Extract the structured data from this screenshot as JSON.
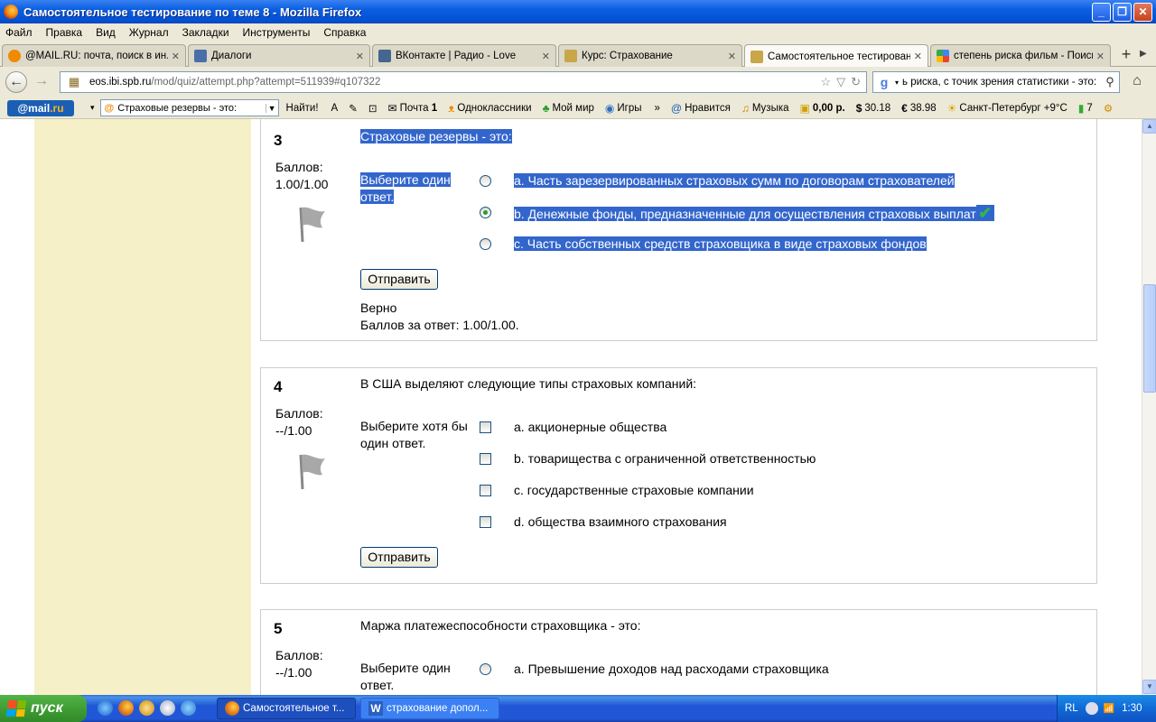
{
  "window": {
    "title": "Самостоятельное тестирование по теме 8 - Mozilla Firefox"
  },
  "menu": [
    "Файл",
    "Правка",
    "Вид",
    "Журнал",
    "Закладки",
    "Инструменты",
    "Справка"
  ],
  "tabs": [
    {
      "label": "@MAIL.RU: почта, поиск в ин...",
      "icon": "mailru-icon"
    },
    {
      "label": "Диалоги",
      "icon": "dialog-icon"
    },
    {
      "label": "ВКонтакте | Радио - Love",
      "icon": "vk-icon"
    },
    {
      "label": "Курс: Страхование",
      "icon": "moodle-icon"
    },
    {
      "label": "Самостоятельное тестирован...",
      "icon": "moodle-icon",
      "active": true
    },
    {
      "label": "степень риска фильм - Поиск ...",
      "icon": "google-icon"
    }
  ],
  "nav": {
    "url_domain": "eos.ibi.spb.ru",
    "url_path": "/mod/quiz/attempt.php?attempt=511939#q107322",
    "search_value": "ь риска, с точик зрения статистики - это:"
  },
  "mailbar": {
    "logo_text": "@mail",
    "logo_suffix": ".ru",
    "search_value": "Страховые резервы - это:",
    "find_label": "Найти!",
    "items": [
      {
        "label": "Почта",
        "badge": "1",
        "icon": "envelope-icon"
      },
      {
        "label": "Одноклассники",
        "icon": "ok-icon"
      },
      {
        "label": "Мой мир",
        "icon": "myworld-icon"
      },
      {
        "label": "Игры",
        "icon": "games-icon"
      },
      {
        "label": "Нравится",
        "icon": "like-icon"
      },
      {
        "label": "Музыка",
        "icon": "music-icon"
      },
      {
        "label": "0,00 р.",
        "icon": "money-icon"
      },
      {
        "label": "30.18",
        "icon": "dollar-icon"
      },
      {
        "label": "38.98",
        "icon": "euro-icon"
      },
      {
        "label": "Санкт-Петербург +9°C",
        "icon": "sun-icon"
      },
      {
        "label": "7",
        "icon": "traffic-light-icon"
      }
    ]
  },
  "questions": [
    {
      "number": "3",
      "grade_label": "Баллов:",
      "grade_value": "1.00/1.00",
      "text": "Страховые резервы - это:",
      "prompt": "Выберите один ответ.",
      "type": "radio",
      "options": [
        {
          "label": "a. Часть зарезервированных страховых сумм по договорам страхователей",
          "checked": false
        },
        {
          "label": "b. Денежные фонды, предназначенные для осуществления страховых выплат",
          "checked": true
        },
        {
          "label": "c. Часть собственных средств страховщика в виде страховых фондов",
          "checked": false
        }
      ],
      "submit_label": "Отправить",
      "feedback_status": "Верно",
      "feedback_score": "Баллов за ответ: 1.00/1.00."
    },
    {
      "number": "4",
      "grade_label": "Баллов:",
      "grade_value": "--/1.00",
      "text": "В США выделяют следующие типы страховых компаний:",
      "prompt": "Выберите хотя бы один ответ.",
      "type": "checkbox",
      "options": [
        {
          "label": "a. акционерные общества",
          "checked": false
        },
        {
          "label": "b. товарищества с ограниченной ответственностью",
          "checked": false
        },
        {
          "label": "c. государственные страховые компании",
          "checked": false
        },
        {
          "label": "d. общества взаимного страхования",
          "checked": false
        }
      ],
      "submit_label": "Отправить"
    },
    {
      "number": "5",
      "grade_label": "Баллов:",
      "grade_value": "--/1.00",
      "text": "Маржа платежеспособности страховщика - это:",
      "prompt": "Выберите один ответ.",
      "type": "radio",
      "options": [
        {
          "label": "a. Превышение доходов над расходами страховщика",
          "checked": false
        }
      ]
    }
  ],
  "taskbar": {
    "start_label": "пуск",
    "items": [
      {
        "label": "Самостоятельное т...",
        "icon": "firefox-icon",
        "active": true
      },
      {
        "label": "страхование допол...",
        "icon": "word-icon",
        "active": false
      }
    ],
    "lang": "RL",
    "clock": "1:30"
  },
  "colors": {
    "selection": "#3366cc",
    "sidebar": "#f5f0c8",
    "taskbar": "#2157d7",
    "start": "#3c9a31"
  }
}
